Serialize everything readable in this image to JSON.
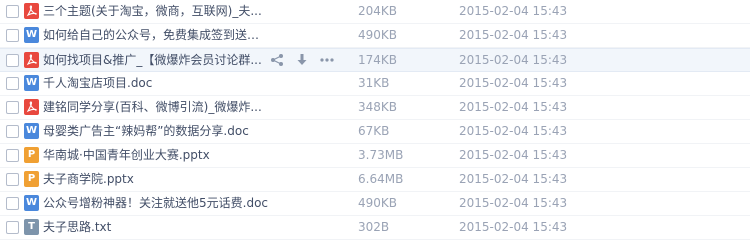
{
  "files": [
    {
      "icon": "pdf-icon",
      "glyph": "",
      "name": "三个主题(关于淘宝，微商，互联网)_夫...",
      "size": "204KB",
      "date": "2015-02-04 15:43"
    },
    {
      "icon": "word-icon",
      "glyph": "W",
      "name": "如何给自己的公众号，免费集成签到送话...",
      "size": "490KB",
      "date": "2015-02-04 15:43"
    },
    {
      "icon": "pdf-icon",
      "glyph": "",
      "name": "如何找项目&推广_【微爆炸会员讨论群...",
      "size": "174KB",
      "date": "2015-02-04 15:43"
    },
    {
      "icon": "word-icon",
      "glyph": "W",
      "name": "千人淘宝店项目.doc",
      "size": "31KB",
      "date": "2015-02-04 15:43"
    },
    {
      "icon": "pdf-icon",
      "glyph": "",
      "name": "建铭同学分享(百科、微博引流)_微爆炸...",
      "size": "348KB",
      "date": "2015-02-04 15:43"
    },
    {
      "icon": "word-icon",
      "glyph": "W",
      "name": "母婴类广告主“辣妈帮”的数据分享.doc",
      "size": "67KB",
      "date": "2015-02-04 15:43"
    },
    {
      "icon": "powerpoint-icon",
      "glyph": "P",
      "name": "华南城·中国青年创业大赛.pptx",
      "size": "3.73MB",
      "date": "2015-02-04 15:43"
    },
    {
      "icon": "powerpoint-icon",
      "glyph": "P",
      "name": "夫子商学院.pptx",
      "size": "6.64MB",
      "date": "2015-02-04 15:43"
    },
    {
      "icon": "word-icon",
      "glyph": "W",
      "name": "公众号增粉神器！关注就送他5元话费.doc",
      "size": "490KB",
      "date": "2015-02-04 15:43"
    },
    {
      "icon": "text-file-icon",
      "glyph": "T",
      "name": "夫子思路.txt",
      "size": "302B",
      "date": "2015-02-04 15:43"
    }
  ],
  "hovered_row_actions": [
    "share-icon",
    "download-icon",
    "more-icon"
  ],
  "colors": {
    "pdf": "#e8483e",
    "word": "#4a88dc",
    "powerpoint": "#f0a033",
    "text": "#7d94ab",
    "hover_row": "#f2f6fb"
  }
}
